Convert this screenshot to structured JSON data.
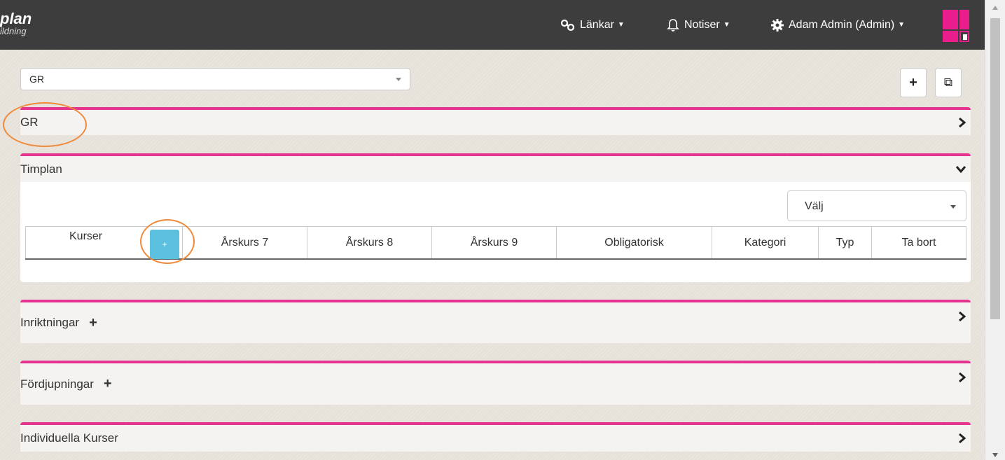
{
  "navbar": {
    "brand_title": "plan",
    "brand_subtitle": "ildning",
    "links_label": "Länkar",
    "notices_label": "Notiser",
    "user_label": "Adam Admin (Admin)"
  },
  "school_select": {
    "value": "GR"
  },
  "toolbar": {
    "add": "+",
    "copy": "⧉"
  },
  "sections": {
    "gr": "GR",
    "timplan": "Timplan",
    "inriktningar": "Inriktningar",
    "fordjupningar": "Fördjupningar",
    "individuella": "Individuella Kurser"
  },
  "timplan": {
    "select_value": "Välj",
    "columns": [
      "Kurser",
      "Årskurs 7",
      "Årskurs 8",
      "Årskurs 9",
      "Obligatorisk",
      "Kategori",
      "Typ",
      "Ta bort"
    ],
    "add_course_label": "+"
  },
  "colors": {
    "accent": "#e5348f",
    "annotation": "#ef8a3a",
    "add_button": "#5bc0de",
    "navbar": "#3d3d3d"
  }
}
